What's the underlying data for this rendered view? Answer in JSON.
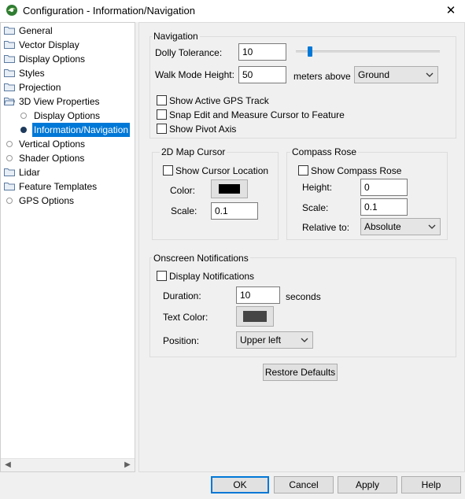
{
  "window": {
    "title": "Configuration - Information/Navigation",
    "close_glyph": "✕"
  },
  "tree": {
    "items": [
      {
        "label": "General",
        "icon": "folder-icon"
      },
      {
        "label": "Vector Display",
        "icon": "folder-icon"
      },
      {
        "label": "Display Options",
        "icon": "folder-icon"
      },
      {
        "label": "Styles",
        "icon": "folder-icon"
      },
      {
        "label": "Projection",
        "icon": "folder-icon"
      },
      {
        "label": "3D View Properties",
        "icon": "folder-open-icon"
      },
      {
        "label": "Display Options",
        "icon": "bullet-icon"
      },
      {
        "label": "Information/Navigation",
        "icon": "bullet-icon",
        "selected": true
      },
      {
        "label": "Vertical Options",
        "icon": "bullet-icon"
      },
      {
        "label": "Shader Options",
        "icon": "bullet-icon"
      },
      {
        "label": "Lidar",
        "icon": "folder-icon"
      },
      {
        "label": "Feature Templates",
        "icon": "folder-icon"
      },
      {
        "label": "GPS Options",
        "icon": "bullet-icon"
      }
    ],
    "scroll_left_glyph": "◀",
    "scroll_right_glyph": "▶"
  },
  "navigation": {
    "group_title": "Navigation",
    "dolly_label": "Dolly Tolerance:",
    "dolly_value": "10",
    "dolly_slider_fraction": 0.08,
    "walk_label": "Walk Mode Height:",
    "walk_value": "50",
    "walk_unit": "meters above",
    "walk_ref_value": "Ground",
    "show_gps_label": "Show Active GPS Track",
    "show_gps_checked": false,
    "snap_label": "Snap Edit and Measure Cursor to Feature",
    "snap_checked": false,
    "pivot_label": "Show Pivot Axis",
    "pivot_checked": false
  },
  "map_cursor": {
    "group_title": "2D Map Cursor",
    "show_label": "Show Cursor Location",
    "show_checked": false,
    "color_label": "Color:",
    "color_value": "#000000",
    "scale_label": "Scale:",
    "scale_value": "0.1"
  },
  "compass": {
    "group_title": "Compass Rose",
    "show_label": "Show Compass Rose",
    "show_checked": false,
    "height_label": "Height:",
    "height_value": "0",
    "scale_label": "Scale:",
    "scale_value": "0.1",
    "relative_label": "Relative to:",
    "relative_value": "Absolute"
  },
  "notifications": {
    "group_title": "Onscreen Notifications",
    "display_label": "Display Notifications",
    "display_checked": false,
    "duration_label": "Duration:",
    "duration_value": "10",
    "duration_unit": "seconds",
    "text_color_label": "Text Color:",
    "text_color_value": "#454545",
    "position_label": "Position:",
    "position_value": "Upper left"
  },
  "buttons": {
    "restore": "Restore Defaults",
    "ok": "OK",
    "cancel": "Cancel",
    "apply": "Apply",
    "help": "Help"
  },
  "colors": {
    "selection": "#0078d7",
    "default_button_border": "#0078d7"
  }
}
